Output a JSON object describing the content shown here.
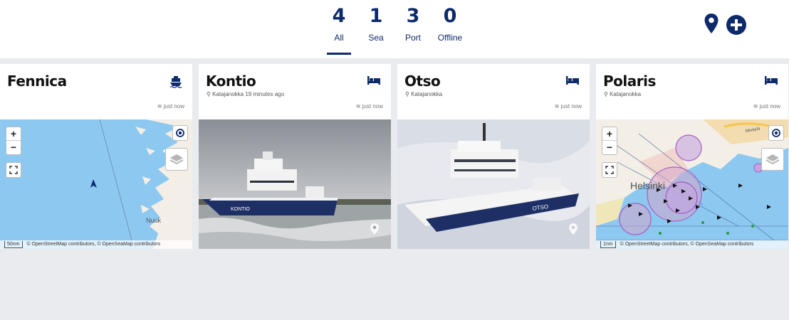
{
  "filters": [
    {
      "count": "4",
      "label": "All",
      "active": true
    },
    {
      "count": "1",
      "label": "Sea",
      "active": false
    },
    {
      "count": "3",
      "label": "Port",
      "active": false
    },
    {
      "count": "0",
      "label": "Offline",
      "active": false
    }
  ],
  "actions": {
    "location_icon": "map-pin-icon",
    "add_icon": "plus-circle-icon"
  },
  "colors": {
    "brand": "#0d2a6b",
    "sea": "#8cc8f0",
    "land": "#f3efe6",
    "background": "#e9ebee"
  },
  "ships": [
    {
      "name": "Fennica",
      "status_icon": "ship-icon",
      "location": "",
      "updated": "just now",
      "media": "map",
      "map_place": "Nuuk",
      "scale": "50nm",
      "attribution": "© OpenStreetMap contributors, © OpenSeaMap contributors"
    },
    {
      "name": "Kontio",
      "status_icon": "bed-icon",
      "location": "Katajanokka 19 minutes ago",
      "updated": "just now",
      "media": "photo",
      "hull_text": "KONTIO"
    },
    {
      "name": "Otso",
      "status_icon": "bed-icon",
      "location": "Katajanokka",
      "updated": "just now",
      "media": "photo",
      "hull_text": "OTSO"
    },
    {
      "name": "Polaris",
      "status_icon": "bed-icon",
      "location": "Katajanokka",
      "updated": "just now",
      "media": "map",
      "map_place": "Helsinki",
      "map_place_2": "Itäväylä",
      "scale": "1nm",
      "attribution": "© OpenStreetMap contributors, © OpenSeaMap contributors"
    }
  ]
}
